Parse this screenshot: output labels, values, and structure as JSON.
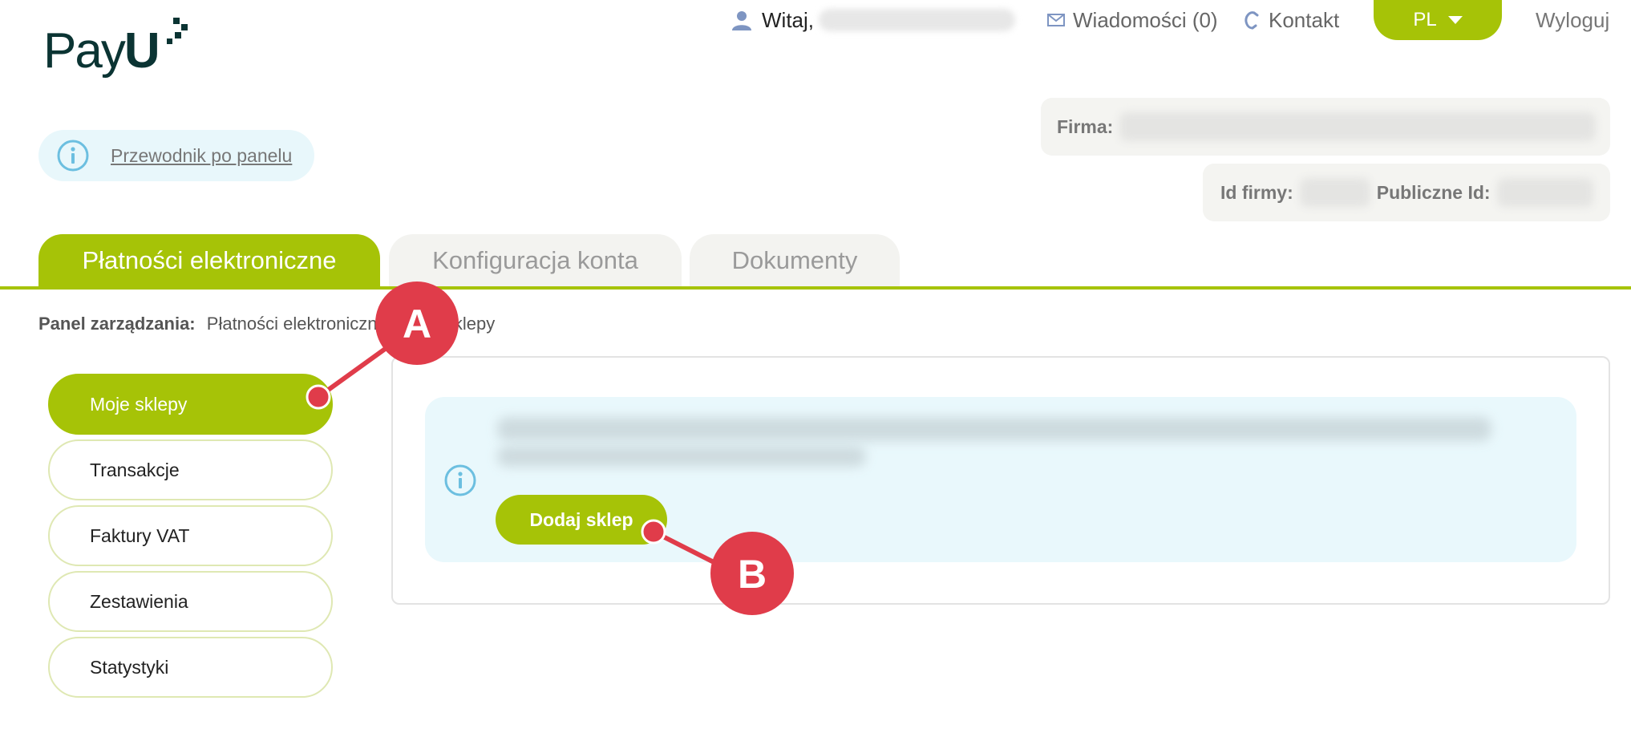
{
  "brand": {
    "logo_text_regular": "Pay",
    "logo_text_bold": "U",
    "accent_color": "#a6c307",
    "dark_color": "#0b3433"
  },
  "topbar": {
    "welcome_label": "Witaj,",
    "messages_label": "Wiadomości (0)",
    "contact_label": "Kontakt",
    "language": "PL",
    "logout_label": "Wyloguj",
    "icons": [
      "user-icon",
      "envelope-icon",
      "phone-icon",
      "caret-down-icon"
    ]
  },
  "guide": {
    "label": "Przewodnik po panelu",
    "icon": "info-icon"
  },
  "company": {
    "company_label": "Firma:",
    "company_id_label": "Id firmy:",
    "public_id_label": "Publiczne Id:"
  },
  "tabs": [
    {
      "label": "Płatności elektroniczne",
      "active": true
    },
    {
      "label": "Konfiguracja konta",
      "active": false
    },
    {
      "label": "Dokumenty",
      "active": false
    }
  ],
  "breadcrumb": {
    "label": "Panel zarządzania:",
    "path": "Płatności elektroniczne / Moje sklepy"
  },
  "menu": [
    {
      "label": "Moje sklepy",
      "active": true
    },
    {
      "label": "Transakcje",
      "active": false
    },
    {
      "label": "Faktury VAT",
      "active": false
    },
    {
      "label": "Zestawienia",
      "active": false
    },
    {
      "label": "Statystyki",
      "active": false
    }
  ],
  "content": {
    "notice_icon": "info-icon",
    "add_button_label": "Dodaj sklep"
  },
  "annotations": {
    "callout_a": "A",
    "callout_b": "B",
    "callout_color": "#e03c4a"
  }
}
